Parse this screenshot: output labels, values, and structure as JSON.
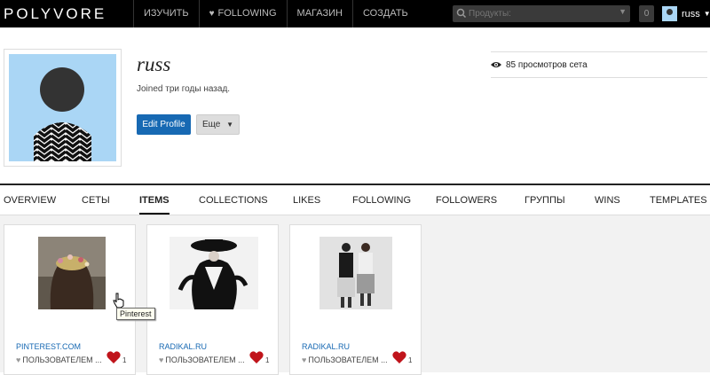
{
  "header": {
    "logo": "POLYVORE",
    "nav": [
      {
        "label": "ИЗУЧИТЬ"
      },
      {
        "label": "FOLLOWING",
        "icon": "heart-icon"
      },
      {
        "label": "МАГАЗИН"
      },
      {
        "label": "СОЗДАТЬ"
      }
    ],
    "search_placeholder": "Продукты:",
    "counter": "0",
    "username": "russ"
  },
  "profile": {
    "name": "russ",
    "joined": "Joined три годы назад.",
    "edit_button": "Edit Profile",
    "more_button": "Еще",
    "views": "85 просмотров сета"
  },
  "tabs": [
    {
      "label": "OVERVIEW",
      "active": false
    },
    {
      "label": "СЕТЫ",
      "active": false
    },
    {
      "label": "ITEMS",
      "active": true
    },
    {
      "label": "COLLECTIONS",
      "active": false
    },
    {
      "label": "LIKES",
      "active": false
    },
    {
      "label": "FOLLOWING",
      "active": false
    },
    {
      "label": "FOLLOWERS",
      "active": false
    },
    {
      "label": "ГРУППЫ",
      "active": false
    },
    {
      "label": "WINS",
      "active": false
    },
    {
      "label": "TEMPLATES",
      "active": false
    }
  ],
  "items": [
    {
      "source": "PINTEREST.COM",
      "users": "ПОЛЬЗОВАТЕЛЕМ ...",
      "likes": "1"
    },
    {
      "source": "RADIKAL.RU",
      "users": "ПОЛЬЗОВАТЕЛЕМ ...",
      "likes": "1"
    },
    {
      "source": "RADIKAL.RU",
      "users": "ПОЛЬЗОВАТЕЛЕМ ...",
      "likes": "1"
    }
  ],
  "tooltip": "Pinterest",
  "colors": {
    "topbar": "#000000",
    "accent_blue": "#1769b3",
    "heart_red": "#c0141b",
    "avatar_bg": "#aad6f5"
  }
}
